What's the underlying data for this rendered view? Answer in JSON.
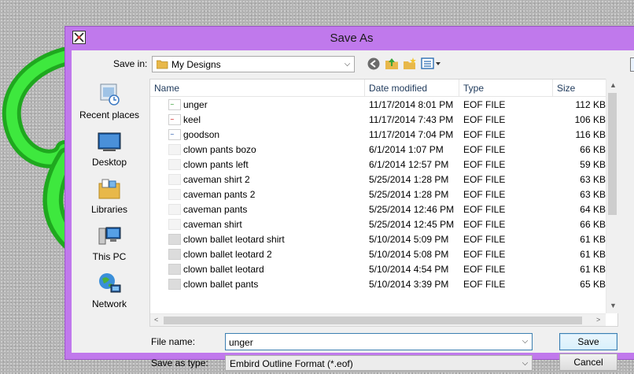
{
  "window": {
    "title": "Save As"
  },
  "save_in": {
    "label": "Save in:",
    "value": "My Designs"
  },
  "places": [
    {
      "label": "Recent places",
      "icon": "recent-places-icon"
    },
    {
      "label": "Desktop",
      "icon": "desktop-icon"
    },
    {
      "label": "Libraries",
      "icon": "libraries-icon"
    },
    {
      "label": "This PC",
      "icon": "this-pc-icon"
    },
    {
      "label": "Network",
      "icon": "network-icon"
    }
  ],
  "columns": {
    "name": "Name",
    "date": "Date modified",
    "type": "Type",
    "size": "Size"
  },
  "files": [
    {
      "name": "unger",
      "date": "11/17/2014 8:01 PM",
      "type": "EOF FILE",
      "size": "112 KB"
    },
    {
      "name": "keel",
      "date": "11/17/2014 7:43 PM",
      "type": "EOF FILE",
      "size": "106 KB"
    },
    {
      "name": "goodson",
      "date": "11/17/2014 7:04 PM",
      "type": "EOF FILE",
      "size": "116 KB"
    },
    {
      "name": "clown pants bozo",
      "date": "6/1/2014 1:07 PM",
      "type": "EOF FILE",
      "size": "66 KB"
    },
    {
      "name": "clown pants left",
      "date": "6/1/2014 12:57 PM",
      "type": "EOF FILE",
      "size": "59 KB"
    },
    {
      "name": "caveman shirt 2",
      "date": "5/25/2014 1:28 PM",
      "type": "EOF FILE",
      "size": "63 KB"
    },
    {
      "name": "caveman pants 2",
      "date": "5/25/2014 1:28 PM",
      "type": "EOF FILE",
      "size": "63 KB"
    },
    {
      "name": "caveman pants",
      "date": "5/25/2014 12:46 PM",
      "type": "EOF FILE",
      "size": "64 KB"
    },
    {
      "name": "caveman shirt",
      "date": "5/25/2014 12:45 PM",
      "type": "EOF FILE",
      "size": "66 KB"
    },
    {
      "name": "clown ballet leotard shirt",
      "date": "5/10/2014 5:09 PM",
      "type": "EOF FILE",
      "size": "61 KB"
    },
    {
      "name": "clown ballet leotard 2",
      "date": "5/10/2014 5:08 PM",
      "type": "EOF FILE",
      "size": "61 KB"
    },
    {
      "name": "clown ballet leotard",
      "date": "5/10/2014 4:54 PM",
      "type": "EOF FILE",
      "size": "61 KB"
    },
    {
      "name": "clown ballet pants",
      "date": "5/10/2014 3:39 PM",
      "type": "EOF FILE",
      "size": "65 KB"
    }
  ],
  "file_name": {
    "label": "File name:",
    "value": "unger"
  },
  "save_as_type": {
    "label": "Save as type:",
    "value": "Embird Outline Format (*.eof)"
  },
  "buttons": {
    "save": "Save",
    "cancel": "Cancel"
  },
  "colors": {
    "frame": "#c079ec",
    "swirl": "#2fd12f",
    "text_header": "#1e395b"
  }
}
